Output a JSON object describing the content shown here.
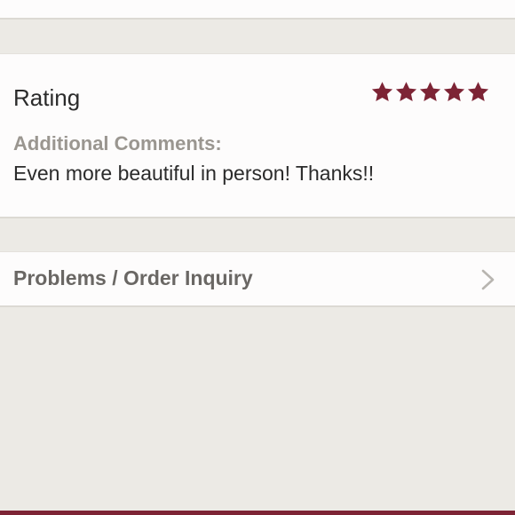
{
  "review": {
    "rating_label": "Rating",
    "rating_stars": 5,
    "rating_max": 5,
    "comments_label": "Additional Comments:",
    "comments_text": "Even more beautiful in person! Thanks!!"
  },
  "inquiry": {
    "label": "Problems / Order Inquiry",
    "icon": "chevron-right-icon"
  },
  "colors": {
    "accent": "#7d2435",
    "background": "#eceae5",
    "card": "#fdfcfc",
    "muted_text": "#9a9690"
  }
}
